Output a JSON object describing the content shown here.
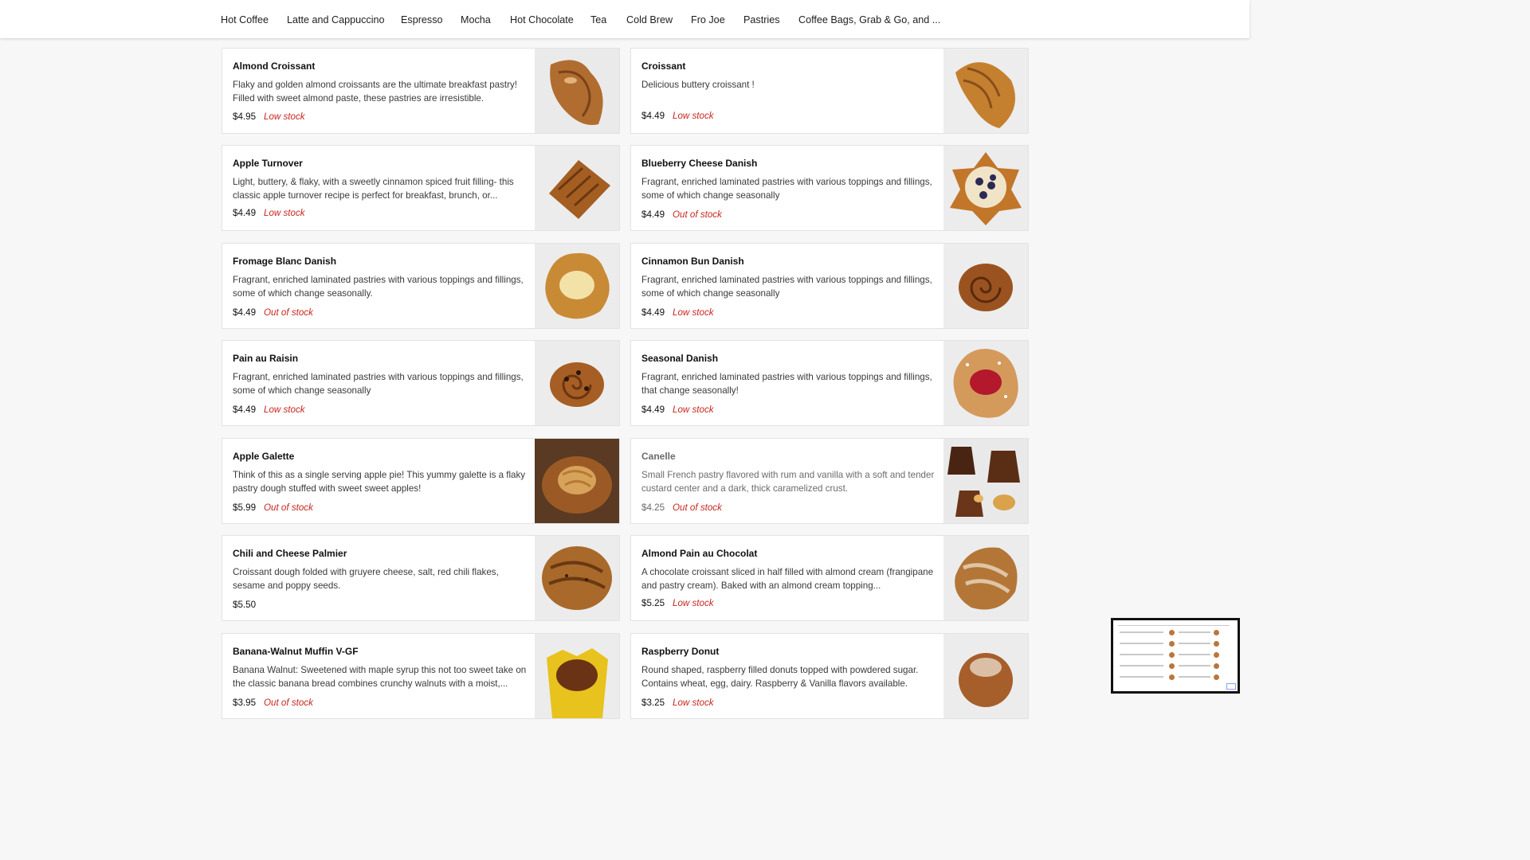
{
  "categories": [
    "Hot Coffee",
    "Latte and Cappuccino",
    "Espresso",
    "Mocha",
    "Hot Chocolate",
    "Tea",
    "Cold Brew",
    "Fro Joe",
    "Pastries",
    "Coffee Bags, Grab & Go, and ..."
  ],
  "products": [
    {
      "name": "Almond Croissant",
      "description": "Flaky and golden almond croissants are the ultimate breakfast pastry! Filled with sweet almond paste, these pastries are irresistible.",
      "price": "$4.95",
      "stock": "Low stock",
      "image": "almond-croissant-image"
    },
    {
      "name": "Croissant",
      "description": "Delicious buttery croissant !",
      "price": "$4.49",
      "stock": "Low stock",
      "image": "croissant-image"
    },
    {
      "name": "Apple Turnover",
      "description": "Light, buttery, & flaky, with a sweetly cinnamon spiced fruit filling- this classic apple turnover recipe is perfect for breakfast, brunch, or...",
      "price": "$4.49",
      "stock": "Low stock",
      "image": "apple-turnover-image"
    },
    {
      "name": "Blueberry Cheese Danish",
      "description": "Fragrant, enriched laminated pastries with various toppings and fillings, some of which change seasonally",
      "price": "$4.49",
      "stock": "Out of stock",
      "image": "blueberry-danish-image"
    },
    {
      "name": "Fromage Blanc Danish",
      "description": "Fragrant, enriched laminated pastries with various toppings and fillings, some of which change seasonally.",
      "price": "$4.49",
      "stock": "Out of stock",
      "image": "fromage-blanc-danish-image"
    },
    {
      "name": "Cinnamon Bun Danish",
      "description": "Fragrant, enriched laminated pastries with various toppings and fillings, some of which change seasonally",
      "price": "$4.49",
      "stock": "Low stock",
      "image": "cinnamon-bun-image"
    },
    {
      "name": "Pain au Raisin",
      "description": "Fragrant, enriched laminated pastries with various toppings and fillings, some of which change seasonally",
      "price": "$4.49",
      "stock": "Low stock",
      "image": "pain-au-raisin-image"
    },
    {
      "name": "Seasonal Danish",
      "description": "Fragrant, enriched laminated pastries with various toppings and fillings, that change seasonally!",
      "price": "$4.49",
      "stock": "Low stock",
      "image": "seasonal-danish-image"
    },
    {
      "name": "Apple Galette",
      "description": "Think of this as a single serving apple pie! This yummy galette is a flaky pastry dough stuffed with sweet sweet apples!",
      "price": "$5.99",
      "stock": "Out of stock",
      "image": "apple-galette-image"
    },
    {
      "name": "Canelle",
      "description": "Small French pastry flavored with rum and vanilla with a soft and tender custard center and a dark, thick caramelized crust.",
      "price": "$4.25",
      "stock": "Out of stock",
      "image": "canelle-image"
    },
    {
      "name": "Chili and Cheese Palmier",
      "description": "Croissant dough folded with gruyere cheese, salt, red chili flakes, sesame and poppy seeds.",
      "price": "$5.50",
      "stock": "",
      "image": "palmier-image"
    },
    {
      "name": "Almond Pain au Chocolat",
      "description": "A chocolate croissant sliced in half filled with almond cream (frangipane and pastry cream). Baked with an almond cream topping...",
      "price": "$5.25",
      "stock": "Low stock",
      "image": "almond-pain-au-chocolat-image"
    },
    {
      "name": "Banana-Walnut Muffin V-GF",
      "description": "Banana Walnut: Sweetened with maple syrup this not too sweet take on the classic banana bread combines crunchy walnuts with a moist,...",
      "price": "$3.95",
      "stock": "Out of stock",
      "image": "muffin-image"
    },
    {
      "name": "Raspberry Donut",
      "description": "Round shaped, raspberry filled donuts topped with powdered sugar. Contains wheat, egg, dairy. Raspberry & Vanilla flavors available.",
      "price": "$3.25",
      "stock": "Low stock",
      "image": "raspberry-donut-image"
    }
  ],
  "colors": {
    "stock": "#c8251e",
    "card_border": "#e2e2e2",
    "background": "#f7f7f7"
  }
}
